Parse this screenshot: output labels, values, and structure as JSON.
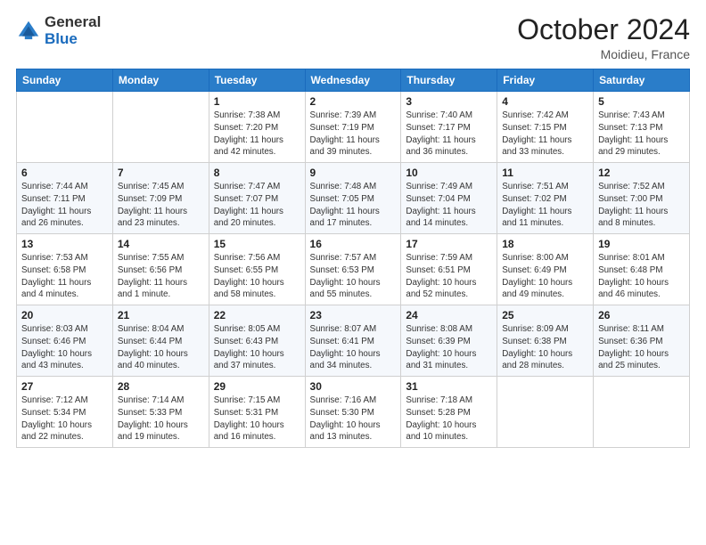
{
  "header": {
    "logo": {
      "general": "General",
      "blue": "Blue"
    },
    "title": "October 2024",
    "location": "Moidieu, France"
  },
  "weekdays": [
    "Sunday",
    "Monday",
    "Tuesday",
    "Wednesday",
    "Thursday",
    "Friday",
    "Saturday"
  ],
  "weeks": [
    [
      null,
      null,
      {
        "day": 1,
        "sunrise": "Sunrise: 7:38 AM",
        "sunset": "Sunset: 7:20 PM",
        "daylight": "Daylight: 11 hours and 42 minutes."
      },
      {
        "day": 2,
        "sunrise": "Sunrise: 7:39 AM",
        "sunset": "Sunset: 7:19 PM",
        "daylight": "Daylight: 11 hours and 39 minutes."
      },
      {
        "day": 3,
        "sunrise": "Sunrise: 7:40 AM",
        "sunset": "Sunset: 7:17 PM",
        "daylight": "Daylight: 11 hours and 36 minutes."
      },
      {
        "day": 4,
        "sunrise": "Sunrise: 7:42 AM",
        "sunset": "Sunset: 7:15 PM",
        "daylight": "Daylight: 11 hours and 33 minutes."
      },
      {
        "day": 5,
        "sunrise": "Sunrise: 7:43 AM",
        "sunset": "Sunset: 7:13 PM",
        "daylight": "Daylight: 11 hours and 29 minutes."
      }
    ],
    [
      {
        "day": 6,
        "sunrise": "Sunrise: 7:44 AM",
        "sunset": "Sunset: 7:11 PM",
        "daylight": "Daylight: 11 hours and 26 minutes."
      },
      {
        "day": 7,
        "sunrise": "Sunrise: 7:45 AM",
        "sunset": "Sunset: 7:09 PM",
        "daylight": "Daylight: 11 hours and 23 minutes."
      },
      {
        "day": 8,
        "sunrise": "Sunrise: 7:47 AM",
        "sunset": "Sunset: 7:07 PM",
        "daylight": "Daylight: 11 hours and 20 minutes."
      },
      {
        "day": 9,
        "sunrise": "Sunrise: 7:48 AM",
        "sunset": "Sunset: 7:05 PM",
        "daylight": "Daylight: 11 hours and 17 minutes."
      },
      {
        "day": 10,
        "sunrise": "Sunrise: 7:49 AM",
        "sunset": "Sunset: 7:04 PM",
        "daylight": "Daylight: 11 hours and 14 minutes."
      },
      {
        "day": 11,
        "sunrise": "Sunrise: 7:51 AM",
        "sunset": "Sunset: 7:02 PM",
        "daylight": "Daylight: 11 hours and 11 minutes."
      },
      {
        "day": 12,
        "sunrise": "Sunrise: 7:52 AM",
        "sunset": "Sunset: 7:00 PM",
        "daylight": "Daylight: 11 hours and 8 minutes."
      }
    ],
    [
      {
        "day": 13,
        "sunrise": "Sunrise: 7:53 AM",
        "sunset": "Sunset: 6:58 PM",
        "daylight": "Daylight: 11 hours and 4 minutes."
      },
      {
        "day": 14,
        "sunrise": "Sunrise: 7:55 AM",
        "sunset": "Sunset: 6:56 PM",
        "daylight": "Daylight: 11 hours and 1 minute."
      },
      {
        "day": 15,
        "sunrise": "Sunrise: 7:56 AM",
        "sunset": "Sunset: 6:55 PM",
        "daylight": "Daylight: 10 hours and 58 minutes."
      },
      {
        "day": 16,
        "sunrise": "Sunrise: 7:57 AM",
        "sunset": "Sunset: 6:53 PM",
        "daylight": "Daylight: 10 hours and 55 minutes."
      },
      {
        "day": 17,
        "sunrise": "Sunrise: 7:59 AM",
        "sunset": "Sunset: 6:51 PM",
        "daylight": "Daylight: 10 hours and 52 minutes."
      },
      {
        "day": 18,
        "sunrise": "Sunrise: 8:00 AM",
        "sunset": "Sunset: 6:49 PM",
        "daylight": "Daylight: 10 hours and 49 minutes."
      },
      {
        "day": 19,
        "sunrise": "Sunrise: 8:01 AM",
        "sunset": "Sunset: 6:48 PM",
        "daylight": "Daylight: 10 hours and 46 minutes."
      }
    ],
    [
      {
        "day": 20,
        "sunrise": "Sunrise: 8:03 AM",
        "sunset": "Sunset: 6:46 PM",
        "daylight": "Daylight: 10 hours and 43 minutes."
      },
      {
        "day": 21,
        "sunrise": "Sunrise: 8:04 AM",
        "sunset": "Sunset: 6:44 PM",
        "daylight": "Daylight: 10 hours and 40 minutes."
      },
      {
        "day": 22,
        "sunrise": "Sunrise: 8:05 AM",
        "sunset": "Sunset: 6:43 PM",
        "daylight": "Daylight: 10 hours and 37 minutes."
      },
      {
        "day": 23,
        "sunrise": "Sunrise: 8:07 AM",
        "sunset": "Sunset: 6:41 PM",
        "daylight": "Daylight: 10 hours and 34 minutes."
      },
      {
        "day": 24,
        "sunrise": "Sunrise: 8:08 AM",
        "sunset": "Sunset: 6:39 PM",
        "daylight": "Daylight: 10 hours and 31 minutes."
      },
      {
        "day": 25,
        "sunrise": "Sunrise: 8:09 AM",
        "sunset": "Sunset: 6:38 PM",
        "daylight": "Daylight: 10 hours and 28 minutes."
      },
      {
        "day": 26,
        "sunrise": "Sunrise: 8:11 AM",
        "sunset": "Sunset: 6:36 PM",
        "daylight": "Daylight: 10 hours and 25 minutes."
      }
    ],
    [
      {
        "day": 27,
        "sunrise": "Sunrise: 7:12 AM",
        "sunset": "Sunset: 5:34 PM",
        "daylight": "Daylight: 10 hours and 22 minutes."
      },
      {
        "day": 28,
        "sunrise": "Sunrise: 7:14 AM",
        "sunset": "Sunset: 5:33 PM",
        "daylight": "Daylight: 10 hours and 19 minutes."
      },
      {
        "day": 29,
        "sunrise": "Sunrise: 7:15 AM",
        "sunset": "Sunset: 5:31 PM",
        "daylight": "Daylight: 10 hours and 16 minutes."
      },
      {
        "day": 30,
        "sunrise": "Sunrise: 7:16 AM",
        "sunset": "Sunset: 5:30 PM",
        "daylight": "Daylight: 10 hours and 13 minutes."
      },
      {
        "day": 31,
        "sunrise": "Sunrise: 7:18 AM",
        "sunset": "Sunset: 5:28 PM",
        "daylight": "Daylight: 10 hours and 10 minutes."
      },
      null,
      null
    ]
  ]
}
